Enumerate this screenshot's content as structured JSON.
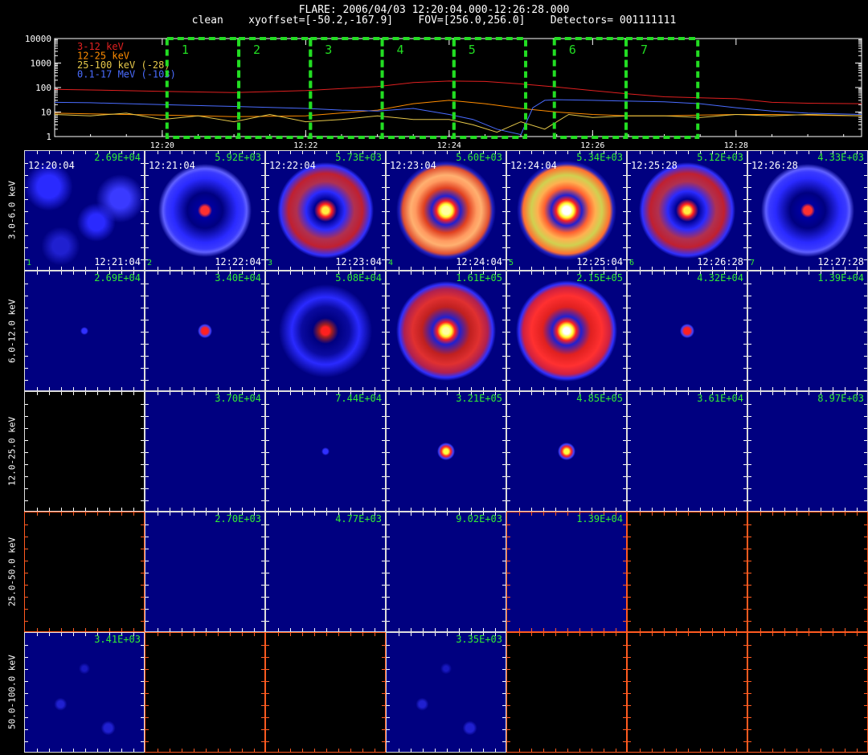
{
  "header": {
    "line1": "FLARE: 2006/04/03 12:20:04.000-12:26:28.000",
    "line2": "clean    xyoffset=[-50.2,-167.9]    FOV=[256.0,256.0]    Detectors= 001111111"
  },
  "chart_data": [
    {
      "type": "line",
      "yscale": "log",
      "ylim": [
        1,
        10000
      ],
      "ytick_labels": [
        "1",
        "10",
        "100",
        "1000",
        "10000"
      ],
      "xtick_labels": [
        "12:20",
        "12:22",
        "12:24",
        "12:26",
        "12:28"
      ],
      "xlim_minutes": [
        "12:18:30",
        "12:29:45"
      ],
      "legend_placement": "top-left",
      "series": [
        {
          "name": "3-12 keV",
          "color": "#e02020",
          "x": [
            "12:18:30",
            "12:19:00",
            "12:20:00",
            "12:21:00",
            "12:22:00",
            "12:23:00",
            "12:23:30",
            "12:24:00",
            "12:24:30",
            "12:25:00",
            "12:25:30",
            "12:26:00",
            "12:26:30",
            "12:27:00",
            "12:27:30",
            "12:28:00",
            "12:28:30",
            "12:29:00",
            "12:29:45"
          ],
          "y": [
            85,
            80,
            70,
            62,
            75,
            110,
            160,
            185,
            178,
            140,
            105,
            75,
            55,
            42,
            38,
            35,
            25,
            23,
            22
          ]
        },
        {
          "name": "12-25 keV",
          "color": "#ff8c00",
          "x": [
            "12:18:30",
            "12:19:00",
            "12:20:00",
            "12:21:00",
            "12:22:00",
            "12:23:00",
            "12:23:30",
            "12:24:00",
            "12:24:30",
            "12:25:00",
            "12:25:30",
            "12:26:00",
            "12:26:30",
            "12:27:00",
            "12:27:30",
            "12:28:00",
            "12:28:30",
            "12:29:00",
            "12:29:45"
          ],
          "y": [
            9,
            8.5,
            7.5,
            6.5,
            7,
            12,
            22,
            30,
            22,
            14,
            10,
            8,
            7,
            7,
            7.5,
            8,
            8,
            7.5,
            7
          ]
        },
        {
          "name": "25-100 keV (-28)",
          "color": "#e6c84a",
          "x": [
            "12:18:30",
            "12:19:00",
            "12:19:30",
            "12:20:00",
            "12:20:30",
            "12:21:00",
            "12:21:30",
            "12:22:00",
            "12:22:30",
            "12:23:00",
            "12:23:30",
            "12:24:00",
            "12:24:20",
            "12:24:40",
            "12:25:00",
            "12:25:20",
            "12:25:40",
            "12:26:00",
            "12:26:30",
            "12:27:00",
            "12:27:30",
            "12:28:00",
            "12:28:30",
            "12:29:00",
            "12:29:45"
          ],
          "y": [
            8,
            7,
            9,
            5,
            7,
            4,
            8,
            4,
            5,
            7,
            5,
            5,
            3,
            1.5,
            4,
            2,
            8,
            6,
            7,
            7,
            6,
            8,
            7,
            8,
            7
          ]
        },
        {
          "name": "0.1-17 MeV (-103)",
          "color": "#4a6cff",
          "x": [
            "12:18:30",
            "12:19:00",
            "12:20:00",
            "12:21:00",
            "12:22:00",
            "12:22:30",
            "12:23:00",
            "12:23:30",
            "12:24:00",
            "12:24:20",
            "12:24:40",
            "12:25:00",
            "12:25:10",
            "12:25:20",
            "12:25:30",
            "12:26:00",
            "12:26:30",
            "12:27:00",
            "12:27:30",
            "12:28:00",
            "12:28:30",
            "12:29:00",
            "12:29:45"
          ],
          "y": [
            25,
            24,
            20,
            17,
            14,
            12,
            11,
            14,
            8,
            5,
            2,
            1.2,
            15,
            30,
            32,
            30,
            28,
            26,
            22,
            15,
            11,
            9,
            8
          ]
        }
      ],
      "intervals": [
        {
          "label": "1",
          "start": "12:20:04",
          "end": "12:21:04"
        },
        {
          "label": "2",
          "start": "12:21:04",
          "end": "12:22:04"
        },
        {
          "label": "3",
          "start": "12:22:04",
          "end": "12:23:04"
        },
        {
          "label": "4",
          "start": "12:23:04",
          "end": "12:24:04"
        },
        {
          "label": "5",
          "start": "12:24:04",
          "end": "12:25:04"
        },
        {
          "label": "6",
          "start": "12:25:28",
          "end": "12:26:28"
        },
        {
          "label": "7",
          "start": "12:26:28",
          "end": "12:27:28"
        }
      ],
      "interval_color": "#22dd22"
    },
    {
      "type": "heatmap",
      "energy_bands": [
        "3.0-6.0 keV",
        "6.0-12.0 keV",
        "12.0-25.0 keV",
        "25.0-50.0 keV",
        "50.0-100.0 keV"
      ],
      "times": [
        {
          "start": "12:20:04",
          "end": "12:21:04",
          "num": "1"
        },
        {
          "start": "12:21:04",
          "end": "12:22:04",
          "num": "2"
        },
        {
          "start": "12:22:04",
          "end": "12:23:04",
          "num": "3"
        },
        {
          "start": "12:23:04",
          "end": "12:24:04",
          "num": "4"
        },
        {
          "start": "12:24:04",
          "end": "12:25:04",
          "num": "5"
        },
        {
          "start": "12:25:28",
          "end": "12:26:28",
          "num": "6"
        },
        {
          "start": "12:26:28",
          "end": "12:27:28",
          "num": "7"
        }
      ],
      "peak_values": [
        [
          "2.69E+04",
          "5.92E+03",
          "5.73E+03",
          "5.60E+03",
          "5.34E+03",
          "5.12E+03",
          "4.33E+03"
        ],
        [
          "2.69E+04",
          "3.40E+04",
          "5.08E+04",
          "1.61E+05",
          "2.15E+05",
          "4.32E+04",
          "1.39E+04"
        ],
        [
          "",
          "3.70E+04",
          "7.44E+04",
          "3.21E+05",
          "4.85E+05",
          "3.61E+04",
          "8.97E+03"
        ],
        [
          "",
          "2.70E+03",
          "4.77E+03",
          "9.02E+03",
          "1.39E+04",
          "",
          ""
        ],
        [
          "3.41E+03",
          "",
          "",
          "3.35E+03",
          "",
          "",
          ""
        ]
      ],
      "images": [
        [
          "noise",
          "ring-faint",
          "ring-med",
          "ring-bright",
          "ring-brightest",
          "ring-med",
          "ring-faint"
        ],
        [
          "dot-tiny",
          "dot-small",
          "ring-dim",
          "ring-mid",
          "ring-strong",
          "dot-small",
          "empty-blue"
        ],
        [
          "black",
          "empty-blue",
          "dot-tiny",
          "dot-med",
          "dot-med",
          "empty-blue",
          "empty-blue"
        ],
        [
          "black-axes",
          "empty-blue",
          "empty-blue",
          "empty-blue",
          "empty-blue-axes",
          "black-axes",
          "black-axes"
        ],
        [
          "noise-sparse",
          "black-axes",
          "black-axes",
          "noise-sparse",
          "black-axes",
          "black-axes",
          "black-axes"
        ]
      ],
      "colors": {
        "background": "#000080",
        "ring_low": "#2a2aff",
        "ring_mid": "#c02020",
        "ring_high": "#ff9a40",
        "core": "#ffff40",
        "axis": "#ff5a20"
      }
    }
  ]
}
